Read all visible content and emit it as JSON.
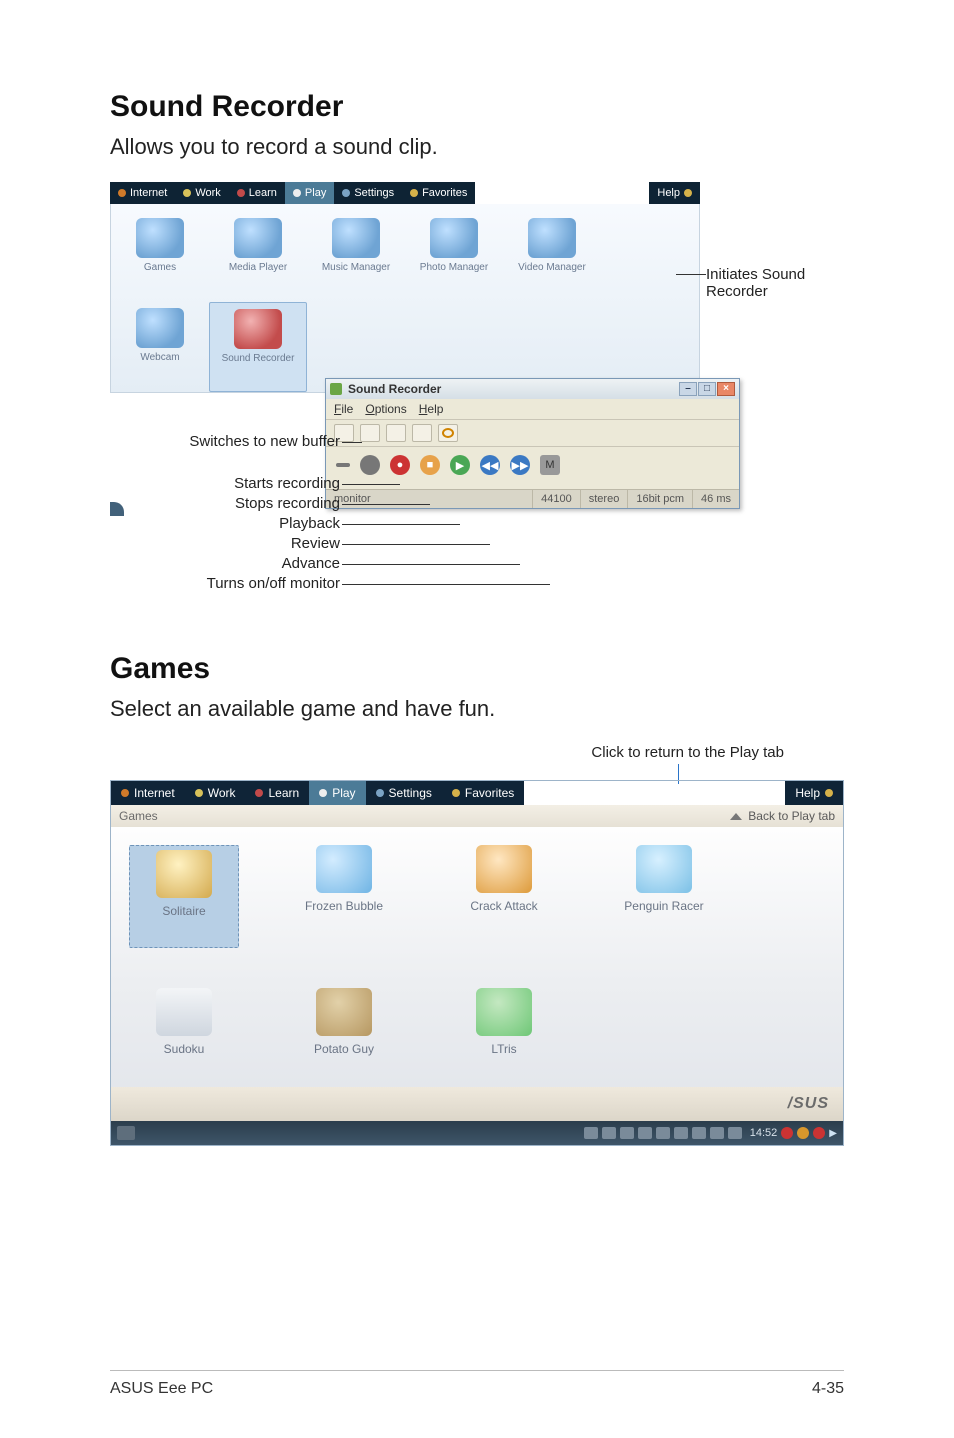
{
  "section1": {
    "title": "Sound Recorder",
    "desc": "Allows you to record a sound clip."
  },
  "launcher1": {
    "tabs": {
      "internet": "Internet",
      "work": "Work",
      "learn": "Learn",
      "play": "Play",
      "settings": "Settings",
      "favorites": "Favorites",
      "help": "Help"
    },
    "icons": {
      "games": "Games",
      "media_player": "Media Player",
      "music_manager": "Music Manager",
      "photo_manager": "Photo Manager",
      "video_manager": "Video Manager",
      "webcam": "Webcam",
      "sound_recorder": "Sound Recorder"
    }
  },
  "callouts1": {
    "initiates_l1": "Initiates Sound",
    "initiates_l2": "Recorder",
    "switches": "Switches to new buffer",
    "starts": "Starts recording",
    "stops": "Stops recording",
    "playback": "Playback",
    "review": "Review",
    "advance": "Advance",
    "monitor_toggle": "Turns on/off monitor"
  },
  "sr": {
    "title": "Sound Recorder",
    "menu": {
      "file": "File",
      "options": "Options",
      "help": "Help"
    },
    "mon_btn": "M",
    "status": {
      "monitor": "monitor",
      "rate": "44100",
      "channels": "stereo",
      "format": "16bit pcm",
      "latency": "46 ms"
    }
  },
  "section2": {
    "title": "Games",
    "desc": "Select an available game and have fun.",
    "callout": "Click to return to the Play tab"
  },
  "launcher2": {
    "tabs": {
      "internet": "Internet",
      "work": "Work",
      "learn": "Learn",
      "play": "Play",
      "settings": "Settings",
      "favorites": "Favorites",
      "help": "Help"
    },
    "subbar": {
      "title": "Games",
      "back": "Back to Play tab"
    },
    "games": {
      "solitaire": "Solitaire",
      "frozen_bubble": "Frozen Bubble",
      "crack_attack": "Crack Attack",
      "penguin_racer": "Penguin Racer",
      "sudoku": "Sudoku",
      "potato_guy": "Potato Guy",
      "ltris": "LTris"
    },
    "brand": "/SUS",
    "clock": "14:52"
  },
  "footer": {
    "left": "ASUS Eee PC",
    "right": "4-35"
  }
}
